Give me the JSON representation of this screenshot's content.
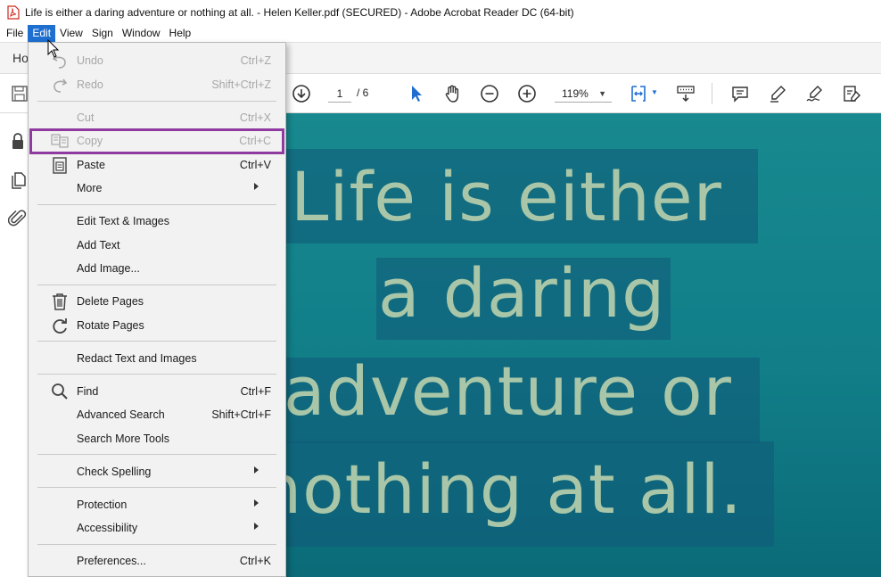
{
  "window": {
    "title": "Life is either a daring adventure or nothing at all. - Helen Keller.pdf (SECURED) - Adobe Acrobat Reader DC (64-bit)"
  },
  "menubar": {
    "items": [
      {
        "label": "File",
        "active": false
      },
      {
        "label": "Edit",
        "active": true
      },
      {
        "label": "View",
        "active": false
      },
      {
        "label": "Sign",
        "active": false
      },
      {
        "label": "Window",
        "active": false
      },
      {
        "label": "Help",
        "active": false
      }
    ]
  },
  "tabs": {
    "home_label": "Ho"
  },
  "toolbar": {
    "page_current": "1",
    "page_total": "/ 6",
    "zoom": "119%",
    "icons": [
      "save-icon",
      "scroll-down-icon",
      "select-arrow-icon",
      "hand-tool-icon",
      "zoom-out-icon",
      "zoom-in-icon",
      "fit-page-icon",
      "keyboard-scroll-icon",
      "comment-icon",
      "highlight-pen-icon",
      "sign-pen-icon",
      "fill-sign-icon"
    ]
  },
  "leftrail": {
    "icons": [
      "lock-icon",
      "pages-icon",
      "attachment-icon"
    ]
  },
  "edit_menu": {
    "items": [
      {
        "label": "Undo",
        "shortcut": "Ctrl+Z",
        "disabled": true,
        "icon": "undo-icon"
      },
      {
        "label": "Redo",
        "shortcut": "Shift+Ctrl+Z",
        "disabled": true,
        "icon": "redo-icon"
      },
      {
        "label": "Cut",
        "shortcut": "Ctrl+X",
        "disabled": true,
        "icon": ""
      },
      {
        "label": "Copy",
        "shortcut": "Ctrl+C",
        "disabled": true,
        "icon": "copy-icon",
        "highlighted": true
      },
      {
        "label": "Paste",
        "shortcut": "Ctrl+V",
        "disabled": false,
        "icon": "paste-icon"
      },
      {
        "label": "More",
        "shortcut": "",
        "disabled": false,
        "submenu": true
      },
      {
        "label": "Edit Text & Images",
        "shortcut": "",
        "disabled": false
      },
      {
        "label": "Add Text",
        "shortcut": "",
        "disabled": false
      },
      {
        "label": "Add Image...",
        "shortcut": "",
        "disabled": false
      },
      {
        "label": "Delete Pages",
        "shortcut": "",
        "disabled": false,
        "icon": "trash-icon"
      },
      {
        "label": "Rotate Pages",
        "shortcut": "",
        "disabled": false,
        "icon": "rotate-icon"
      },
      {
        "label": "Redact Text and Images",
        "shortcut": "",
        "disabled": false
      },
      {
        "label": "Find",
        "shortcut": "Ctrl+F",
        "disabled": false,
        "icon": "search-icon"
      },
      {
        "label": "Advanced Search",
        "shortcut": "Shift+Ctrl+F",
        "disabled": false
      },
      {
        "label": "Search More Tools",
        "shortcut": "",
        "disabled": false
      },
      {
        "label": "Check Spelling",
        "shortcut": "",
        "disabled": false,
        "submenu": true
      },
      {
        "label": "Protection",
        "shortcut": "",
        "disabled": false,
        "submenu": true
      },
      {
        "label": "Accessibility",
        "shortcut": "",
        "disabled": false,
        "submenu": true
      },
      {
        "label": "Preferences...",
        "shortcut": "Ctrl+K",
        "disabled": false
      }
    ]
  },
  "document": {
    "lines": [
      "Life is either",
      "a daring",
      "adventure or",
      "nothing at all."
    ],
    "text_color": "#a9c7a8",
    "background_color": "#138590"
  },
  "colors": {
    "menu_active": "#1e6fd0",
    "highlight_box": "#8e3a9e",
    "icon_blue": "#1e6fd0"
  }
}
